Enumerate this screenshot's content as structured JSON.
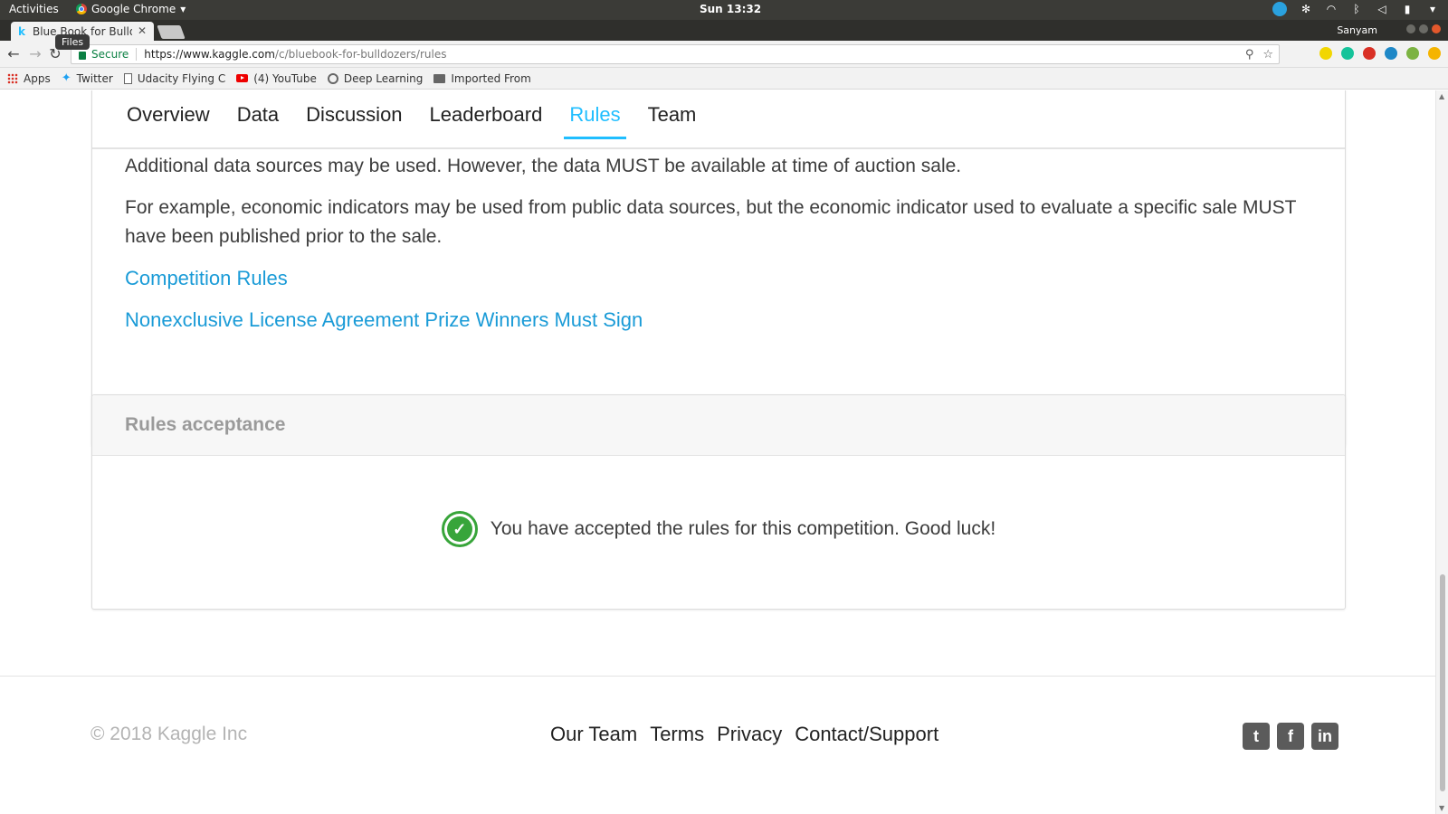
{
  "system_bar": {
    "activities": "Activities",
    "app_name": "Google Chrome",
    "clock": "Sun 13:32"
  },
  "browser": {
    "tab_title": "Blue Book for Bulld",
    "tooltip": "Files",
    "profile_name": "Sanyam",
    "secure_label": "Secure",
    "url_host": "https://www.kaggle.com",
    "url_path": "/c/bluebook-for-bulldozers/rules",
    "bookmarks": [
      {
        "label": "Apps",
        "icon": "apps-icon"
      },
      {
        "label": "Twitter",
        "icon": "twitter-icon"
      },
      {
        "label": "Udacity Flying C",
        "icon": "page-icon"
      },
      {
        "label": "(4) YouTube",
        "icon": "youtube-icon"
      },
      {
        "label": "Deep Learning",
        "icon": "deep-learning-icon"
      },
      {
        "label": "Imported From",
        "icon": "folder-icon"
      }
    ]
  },
  "page": {
    "tabs": [
      {
        "label": "Overview",
        "active": false
      },
      {
        "label": "Data",
        "active": false
      },
      {
        "label": "Discussion",
        "active": false
      },
      {
        "label": "Leaderboard",
        "active": false
      },
      {
        "label": "Rules",
        "active": true
      },
      {
        "label": "Team",
        "active": false
      }
    ],
    "paragraphs": [
      "Additional data sources may be used.  However, the data MUST be available at time of auction sale.",
      "For example, economic indicators may be used from public data sources, but the economic indicator used to evaluate a specific sale MUST have been published prior to the sale."
    ],
    "links": [
      "Competition Rules",
      "Nonexclusive License Agreement Prize Winners Must Sign"
    ],
    "acceptance": {
      "header": "Rules acceptance",
      "message": "You have accepted the rules for this competition. Good luck!"
    }
  },
  "footer": {
    "copyright": "© 2018 Kaggle Inc",
    "links": [
      "Our Team",
      "Terms",
      "Privacy",
      "Contact/Support"
    ],
    "social": [
      "twitter-icon",
      "facebook-icon",
      "linkedin-icon"
    ]
  },
  "colors": {
    "accent": "#20beff",
    "link": "#1a9bd7",
    "success": "#38a53a"
  }
}
